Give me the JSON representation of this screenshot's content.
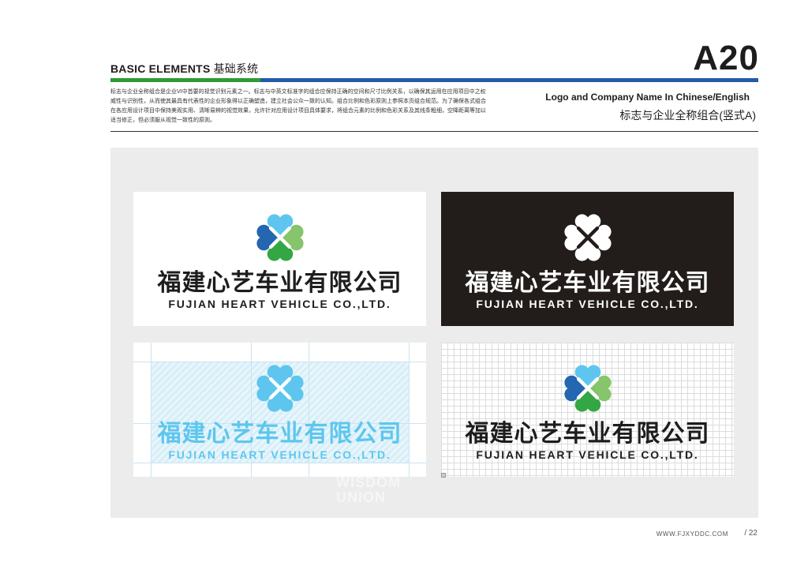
{
  "header": {
    "section_en": "BASIC ELEMENTS",
    "section_zh": "基础系统",
    "page_code": "A20",
    "description": "标志与企业全称组合是企业VI中首要的视觉识别元素之一。标志与中英文标准字的组合应保持正确的空间和尺寸比例关系，以确保其运用在应用项目中之权威性与识别性，从而使其最具有代表性的企业形象得以正确塑造，建立社会公众一致的认知。组合比例和色彩原则上参照本页组合规范。为了确保各式组合在各应用设计项目中保持美观实用、清晰易辨的视觉效果，允许针对应用设计项目具体要求，将组合元素的比例和色彩关系及其线条粗细，空降距离等加以适当修正，但必须服从视觉一致性的原则。",
    "subtitle_en": "Logo and Company Name In  Chinese/English",
    "subtitle_zh": "标志与企业全称组合(竖式A)"
  },
  "logo": {
    "company_cn": "福建心艺车业有限公司",
    "company_en": "FUJIAN HEART VEHICLE CO.,LTD.",
    "icon_name": "four-heart-clover-x-icon",
    "colors": {
      "top_heart": "#5ec6ee",
      "left_heart": "#2466b0",
      "right_heart": "#86c56b",
      "bottom_heart": "#33a744",
      "dark_background": "#221c1a",
      "tint": "#5ec6ee"
    }
  },
  "panels": [
    {
      "variant": "full-color-on-white"
    },
    {
      "variant": "reversed-on-black"
    },
    {
      "variant": "single-color-blue-with-guides"
    },
    {
      "variant": "full-color-on-grid"
    }
  ],
  "watermark": {
    "line1": "WISDOM",
    "line2": "UNION"
  },
  "footer": {
    "url": "WWW.FJXYDDC.COM",
    "page": "/ 22"
  }
}
